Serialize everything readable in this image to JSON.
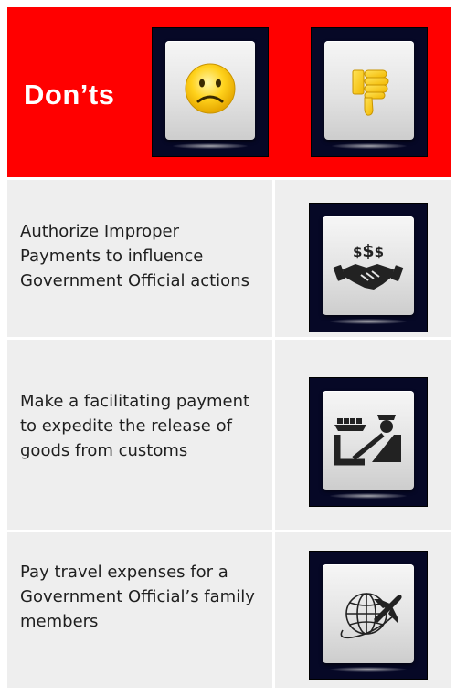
{
  "header": {
    "title": "Don’ts",
    "icons": [
      "sad-face-icon",
      "thumbs-down-icon"
    ]
  },
  "items": [
    {
      "text": "Authorize Improper Payments to influence Government Official actions",
      "icon": "handshake-money-icon"
    },
    {
      "text": "Make a facilitating payment to expedite the release of goods from customs",
      "icon": "customs-cargo-icon"
    },
    {
      "text": "Pay travel expenses for a Government Official’s family members",
      "icon": "globe-airplane-icon"
    }
  ],
  "colors": {
    "header_bg": "#ff0000",
    "row_bg": "#eeeeee",
    "tile_bg": "#060826",
    "emoji_yellow": "#ffd21c"
  }
}
